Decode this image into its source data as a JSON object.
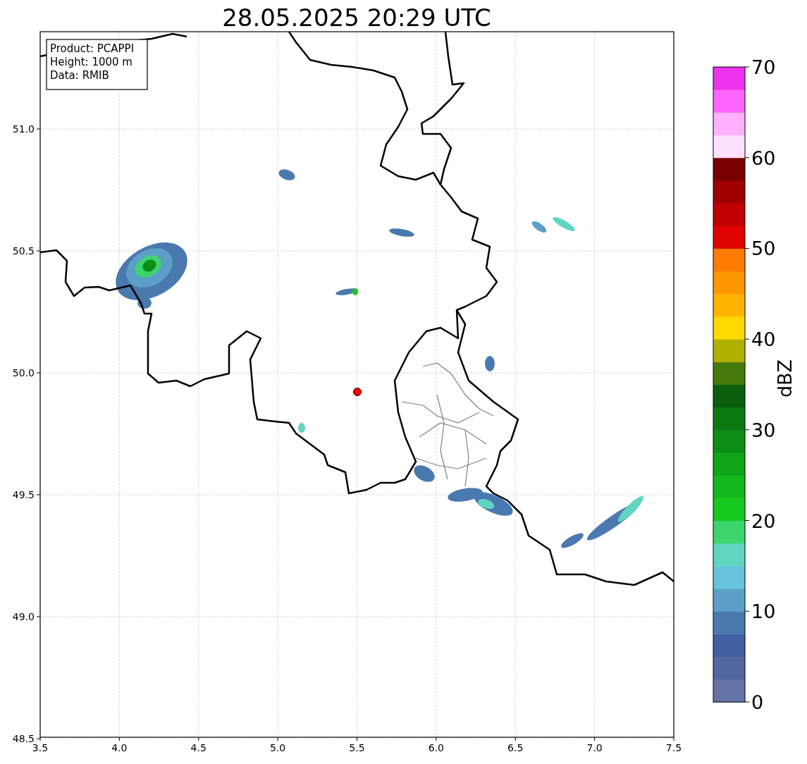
{
  "title": "28.05.2025 20:29 UTC",
  "info_box": [
    "Product: PCAPPI",
    "Height: 1000 m",
    "Data: RMIB"
  ],
  "map": {
    "x_ticks": [
      "3.5",
      "4.0",
      "4.5",
      "5.0",
      "5.5",
      "6.0",
      "6.5",
      "7.0",
      "7.5"
    ],
    "y_ticks": [
      "51.0",
      "50.5",
      "50.0",
      "49.5",
      "49.0",
      "48.5"
    ]
  },
  "colorbar": {
    "label": "dBZ",
    "ticks": [
      "70",
      "60",
      "50",
      "40",
      "30",
      "20",
      "10",
      "0"
    ],
    "bins": [
      {
        "color": "#6474a8"
      },
      {
        "color": "#53679f"
      },
      {
        "color": "#4460a4"
      },
      {
        "color": "#4a79b0"
      },
      {
        "color": "#5b9fc8"
      },
      {
        "color": "#67c2de"
      },
      {
        "color": "#60d6c2"
      },
      {
        "color": "#3dd46e"
      },
      {
        "color": "#14c81e"
      },
      {
        "color": "#12b81c"
      },
      {
        "color": "#10a418"
      },
      {
        "color": "#0e8e16"
      },
      {
        "color": "#0b7a12"
      },
      {
        "color": "#0a5e0e"
      },
      {
        "color": "#467a0c"
      },
      {
        "color": "#b0b000"
      },
      {
        "color": "#ffd800"
      },
      {
        "color": "#ffb400"
      },
      {
        "color": "#ff9800"
      },
      {
        "color": "#ff7c00"
      },
      {
        "color": "#e00000"
      },
      {
        "color": "#c00000"
      },
      {
        "color": "#a00000"
      },
      {
        "color": "#780000"
      },
      {
        "color": "#ffe0ff"
      },
      {
        "color": "#ffb0ff"
      },
      {
        "color": "#ff66ff"
      },
      {
        "color": "#ee33ee"
      }
    ]
  }
}
